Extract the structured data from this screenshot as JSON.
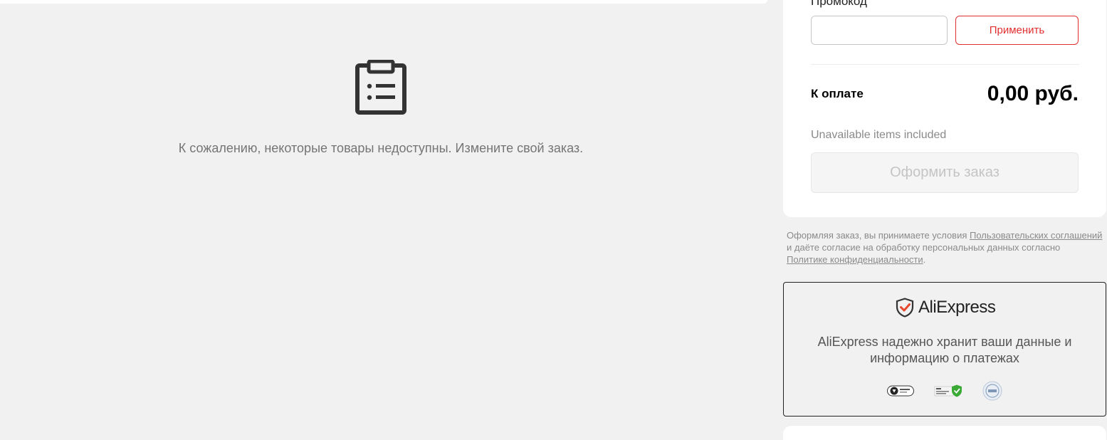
{
  "empty_state": {
    "icon": "clipboard-list-icon",
    "message": "К сожалению, некоторые товары недоступны. Измените свой заказ."
  },
  "summary": {
    "promo_label": "Промокод",
    "promo_value": "",
    "apply_label": "Применить",
    "total_label": "К оплате",
    "total_value": "0,00 руб.",
    "unavailable_note": "Unavailable items included",
    "checkout_label": "Оформить заказ"
  },
  "terms": {
    "prefix": "Оформляя заказ, вы принимаете условия ",
    "user_agreements_link": "Пользовательских соглашений",
    "middle": " и даёте согласие на обработку персональных данных согласно ",
    "privacy_link": "Политике конфиденциальности",
    "suffix": "."
  },
  "security": {
    "logo_icon": "shield-check-icon",
    "logo_text": "AliExpress",
    "text_line1": "AliExpress надежно хранит ваши данные и",
    "text_line2": "информацию о платежах",
    "badges": [
      "bsi-badge-icon",
      "ssl-secure-badge-icon",
      "iso-seal-badge-icon"
    ]
  },
  "colors": {
    "accent_red": "#e22e2e",
    "background": "#f1f1f1",
    "muted_text": "#8a8a8a"
  }
}
